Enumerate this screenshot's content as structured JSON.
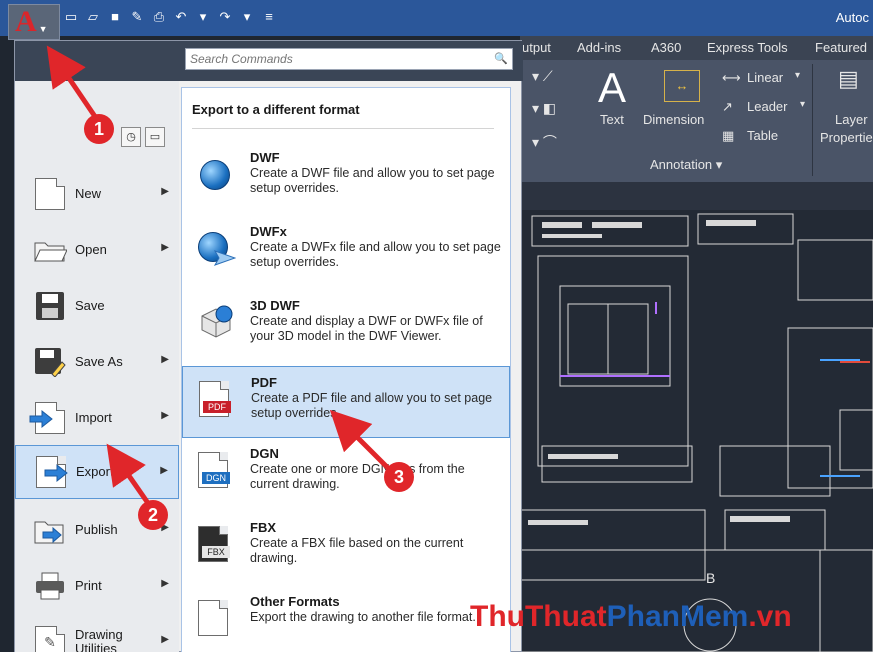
{
  "window": {
    "title": "Autoc"
  },
  "app_button": {
    "letter": "A"
  },
  "ribbon": {
    "tabs": [
      {
        "label": "utput"
      },
      {
        "label": "Add-ins"
      },
      {
        "label": "A360"
      },
      {
        "label": "Express Tools"
      },
      {
        "label": "Featured"
      }
    ],
    "tools": {
      "text": "Text",
      "dimension": "Dimension",
      "linear": "Linear",
      "leader": "Leader",
      "table": "Table",
      "layer_line1": "Layer",
      "layer_line2": "Properties"
    },
    "panel_title": "Annotation"
  },
  "search": {
    "placeholder": "Search Commands"
  },
  "menu": {
    "items": [
      {
        "label": "New",
        "has_arrow": true
      },
      {
        "label": "Open",
        "has_arrow": true
      },
      {
        "label": "Save",
        "has_arrow": false
      },
      {
        "label": "Save As",
        "has_arrow": true
      },
      {
        "label": "Import",
        "has_arrow": true
      },
      {
        "label": "Export",
        "has_arrow": true,
        "active": true
      },
      {
        "label": "Publish",
        "has_arrow": true
      },
      {
        "label": "Print",
        "has_arrow": true
      },
      {
        "label_line1": "Drawing",
        "label_line2": "Utilities",
        "has_arrow": true
      }
    ]
  },
  "export_panel": {
    "title": "Export to a different format",
    "formats": [
      {
        "title": "DWF",
        "desc": "Create a DWF file and allow you to set page setup overrides."
      },
      {
        "title": "DWFx",
        "desc": "Create a DWFx file and allow you to set page setup overrides."
      },
      {
        "title": "3D DWF",
        "desc": "Create and display a DWF or DWFx file of your 3D model in the DWF Viewer."
      },
      {
        "title": "PDF",
        "desc": "Create a PDF file and allow you to set page setup overrides.",
        "icon_tag": "PDF",
        "active": true
      },
      {
        "title": "DGN",
        "desc": "Create one or more DGN files from the current drawing.",
        "icon_tag": "DGN"
      },
      {
        "title": "FBX",
        "desc": "Create a FBX file based on the current drawing.",
        "icon_tag": "FBX"
      },
      {
        "title": "Other Formats",
        "desc": "Export the drawing to another file format."
      }
    ]
  },
  "annotations": {
    "badge1": "1",
    "badge2": "2",
    "badge3": "3"
  },
  "canvas": {
    "letter": "B"
  },
  "watermark": {
    "part1": "ThuThuat",
    "part2": "PhanMem",
    "part3": ".vn"
  },
  "colors": {
    "accent_red": "#e0262a",
    "hover_blue": "#cfe2f7",
    "title_blue": "#2b579a"
  }
}
